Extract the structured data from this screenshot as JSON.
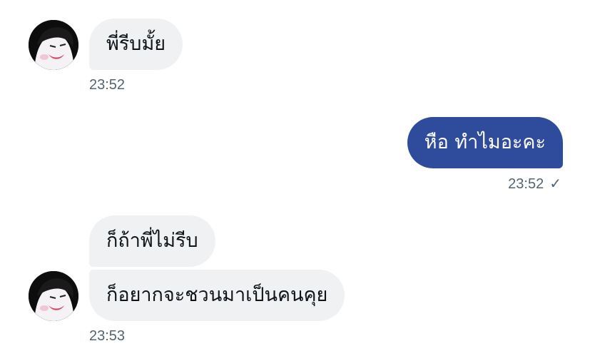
{
  "messages": [
    {
      "direction": "received",
      "text": "พี่รีบมั้ย",
      "time": "23:52"
    },
    {
      "direction": "sent",
      "text": "หือ ทำไมอะคะ",
      "time": "23:52",
      "status_icon": "check-icon"
    },
    {
      "direction": "received",
      "text": "ก็ถ้าพี่ไม่รีบ"
    },
    {
      "direction": "received",
      "text": "ก็อยากจะชวนมาเป็นคนคุย",
      "time": "23:53"
    }
  ],
  "status": {
    "check_glyph": "✓"
  },
  "colors": {
    "sent_bubble": "#2f4b9c",
    "received_bubble": "#eff1f3",
    "timestamp": "#536471"
  }
}
